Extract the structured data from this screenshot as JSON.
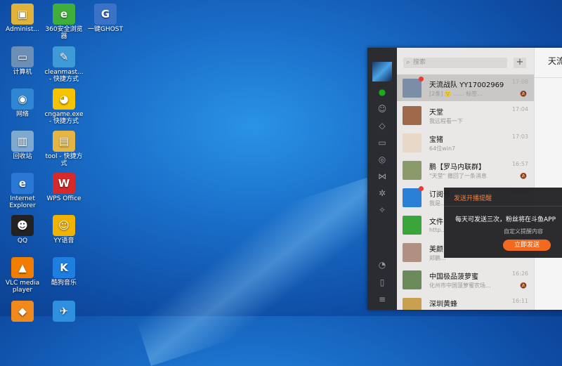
{
  "desktop": {
    "icons": [
      {
        "label": "Administ...",
        "icon": "user-folder-icon",
        "color": "#e0b33a"
      },
      {
        "label": "360安全浏览器",
        "icon": "browser-360-icon",
        "color": "#3fae3a"
      },
      {
        "label": "一键GHOST",
        "icon": "ghost-icon",
        "color": "#3a72c8"
      },
      {
        "label": "计算机",
        "icon": "computer-icon",
        "color": "#6c8fb8"
      },
      {
        "label": "cleanmast... - 快捷方式",
        "icon": "broom-icon",
        "color": "#3f9ad8"
      },
      {
        "label": "网络",
        "icon": "network-icon",
        "color": "#2f86d1"
      },
      {
        "label": "cngame.exe - 快捷方式",
        "icon": "pacman-icon",
        "color": "#f5c300"
      },
      {
        "label": "回收站",
        "icon": "recycle-bin-icon",
        "color": "#7fa9cf"
      },
      {
        "label": "tool - 快捷方式",
        "icon": "folder-icon",
        "color": "#e4b545"
      },
      {
        "label": "Internet Explorer",
        "icon": "ie-icon",
        "color": "#2a77d4"
      },
      {
        "label": "WPS Office",
        "icon": "wps-icon",
        "color": "#d62a2a"
      },
      {
        "label": "QQ",
        "icon": "qq-penguin-icon",
        "color": "#222222"
      },
      {
        "label": "YY语音",
        "icon": "yy-icon",
        "color": "#f2b300"
      },
      {
        "label": "VLC media player",
        "icon": "vlc-cone-icon",
        "color": "#f07d00"
      },
      {
        "label": "酷狗音乐",
        "icon": "kugou-icon",
        "color": "#1f7fe0"
      },
      {
        "label": "",
        "icon": "app-orange-icon",
        "color": "#f08a1c"
      },
      {
        "label": "",
        "icon": "bird-icon",
        "color": "#2f8fe0"
      }
    ]
  },
  "wechat": {
    "search_placeholder": "搜索",
    "add_label": "+",
    "sidebar_icons": [
      "chat-icon",
      "contacts-icon",
      "cube-icon",
      "folder-icon",
      "settings-circle-icon",
      "butterfly-icon",
      "gear-icon",
      "star-icon",
      "timer-icon",
      "phone-icon",
      "menu-icon"
    ],
    "chats": [
      {
        "name": "天流战队 YY17002969",
        "preview": "[2条] 🙂 ...... 标签...",
        "time": "17:08",
        "muted": true,
        "unread": true,
        "avatar": "#7a8ea8"
      },
      {
        "name": "天堂",
        "preview": "我远程看一下",
        "time": "17:04",
        "muted": false,
        "unread": false,
        "avatar": "#a06a4a"
      },
      {
        "name": "宝猪",
        "preview": "64位win7",
        "time": "17:03",
        "muted": false,
        "unread": false,
        "avatar": "#e8d8c8"
      },
      {
        "name": "鹏【罗马内联群】",
        "preview": "\"天堂\" 撤回了一条消息",
        "time": "16:57",
        "muted": true,
        "unread": false,
        "avatar": "#8a9a6a"
      },
      {
        "name": "订阅号",
        "preview": "我是...",
        "time": "16:36",
        "muted": false,
        "unread": true,
        "avatar": "#2a7fd6"
      },
      {
        "name": "文件",
        "preview": "http...",
        "time": "",
        "muted": false,
        "unread": false,
        "avatar": "#3aa53a"
      },
      {
        "name": "美颜",
        "preview": "郑鹏...",
        "time": "",
        "muted": false,
        "unread": false,
        "avatar": "#b09080"
      },
      {
        "name": "中国极品菠萝蜜",
        "preview": "化州市中国菠萝蜜农场...",
        "time": "16:26",
        "muted": true,
        "unread": false,
        "avatar": "#6a8a5a"
      },
      {
        "name": "深圳黄蜂",
        "preview": "宋点观战3号房 - 新问码",
        "time": "16:11",
        "muted": true,
        "unread": false,
        "avatar": "#c8a050"
      }
    ],
    "right_title": "天流"
  },
  "popup": {
    "title": "发送开播提醒",
    "message": "每天可发送三次，粉丝将在斗鱼APP",
    "link": "自定义提醒内容",
    "button": "立即发送"
  }
}
